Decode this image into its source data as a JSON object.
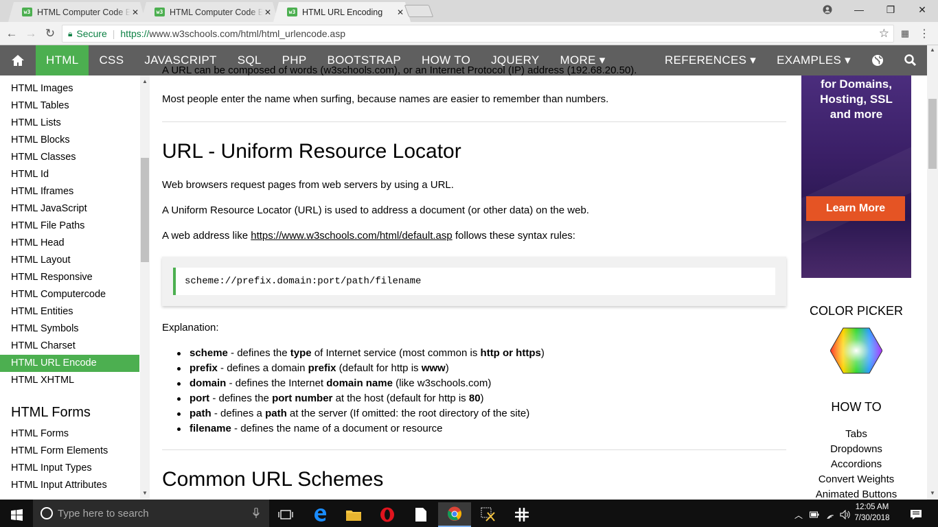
{
  "browser": {
    "tabs": [
      {
        "title": "HTML Computer Code El"
      },
      {
        "title": "HTML Computer Code El"
      },
      {
        "title": "HTML URL Encoding"
      }
    ],
    "favicon_text": "w3",
    "close_glyph": "✕",
    "window_controls": {
      "minimize": "—",
      "maximize": "❐",
      "close": "✕"
    },
    "secure_label": "Secure",
    "url_prefix": "https://",
    "url_rest": "www.w3schools.com/html/html_urlencode.asp"
  },
  "topnav": {
    "items": [
      "HTML",
      "CSS",
      "JAVASCRIPT",
      "SQL",
      "PHP",
      "BOOTSTRAP",
      "HOW TO",
      "JQUERY",
      "MORE ▾"
    ],
    "right_items": [
      "REFERENCES ▾",
      "EXAMPLES ▾"
    ],
    "active": "HTML"
  },
  "sidebar": {
    "items": [
      "HTML Images",
      "HTML Tables",
      "HTML Lists",
      "HTML Blocks",
      "HTML Classes",
      "HTML Id",
      "HTML Iframes",
      "HTML JavaScript",
      "HTML File Paths",
      "HTML Head",
      "HTML Layout",
      "HTML Responsive",
      "HTML Computercode",
      "HTML Entities",
      "HTML Symbols",
      "HTML Charset",
      "HTML URL Encode",
      "HTML XHTML"
    ],
    "active_index": 16,
    "section_heading": "HTML Forms",
    "forms_items": [
      "HTML Forms",
      "HTML Form Elements",
      "HTML Input Types",
      "HTML Input Attributes"
    ]
  },
  "main": {
    "partial_top": "A URL can be composed of words (w3schools.com), or an Internet Protocol (IP) address (192.68.20.50).",
    "para1": "Most people enter the name when surfing, because names are easier to remember than numbers.",
    "heading_url": "URL - Uniform Resource Locator",
    "para2": "Web browsers request pages from web servers by using a URL.",
    "para3": "A Uniform Resource Locator (URL) is used to address a document (or other data) on the web.",
    "para4_pre": "A web address like ",
    "para4_link": "https://www.w3schools.com/html/default.asp",
    "para4_post": " follows these syntax rules:",
    "code": "scheme://prefix.domain:port/path/filename",
    "explanation": "Explanation:",
    "list": {
      "scheme": {
        "term": "scheme",
        "a": " - defines the ",
        "b": "type",
        "c": " of Internet service (most common is ",
        "d": "http or https",
        "e": ")"
      },
      "prefix": {
        "term": "prefix",
        "a": " - defines a domain ",
        "b": "prefix",
        "c": " (default for http is ",
        "d": "www",
        "e": ")"
      },
      "domain": {
        "term": "domain",
        "a": " - defines the Internet ",
        "b": "domain name",
        "c": " (like w3schools.com)"
      },
      "port": {
        "term": "port",
        "a": " - defines the ",
        "b": "port number",
        "c": " at the host (default for http is ",
        "d": "80",
        "e": ")"
      },
      "path": {
        "term": "path",
        "a": " - defines a ",
        "b": "path",
        "c": " at the server (If omitted: the root directory of the site)"
      },
      "filename": {
        "term": "filename",
        "a": " - defines the name of a document or resource"
      }
    },
    "heading_schemes": "Common URL Schemes"
  },
  "ad": {
    "line1": "for Domains,",
    "line2": "Hosting, SSL",
    "line3": "and more",
    "button": "Learn More"
  },
  "right": {
    "color_picker": "COLOR PICKER",
    "howto": "HOW TO",
    "links": [
      "Tabs",
      "Dropdowns",
      "Accordions",
      "Convert Weights",
      "Animated Buttons"
    ]
  },
  "taskbar": {
    "search_placeholder": "Type here to search",
    "time": "12:05 AM",
    "date": "7/30/2018"
  },
  "colors": {
    "accent": "#4CAF50",
    "nav_bg": "#5f5f5f",
    "ad_button": "#e55424"
  }
}
